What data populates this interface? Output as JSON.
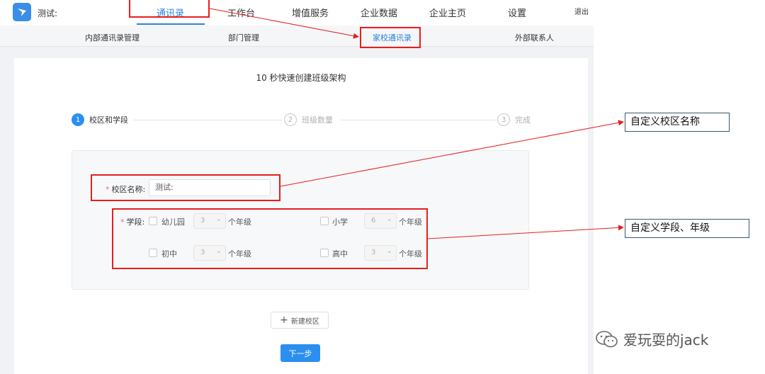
{
  "header": {
    "brand": "测试:",
    "nav": [
      {
        "label": "通讯录",
        "active": true
      },
      {
        "label": "工作台",
        "active": false
      },
      {
        "label": "增值服务",
        "active": false
      },
      {
        "label": "企业数据",
        "active": false
      },
      {
        "label": "企业主页",
        "active": false
      },
      {
        "label": "设置",
        "active": false
      }
    ],
    "logout": "退出"
  },
  "subnav": [
    {
      "label": "内部通讯录管理",
      "active": false
    },
    {
      "label": "部门管理",
      "active": false
    },
    {
      "label": "家校通讯录",
      "active": true
    },
    {
      "label": "外部联系人",
      "active": false
    }
  ],
  "page": {
    "title": "10 秒快速创建班级架构",
    "steps": [
      {
        "num": "1",
        "label": "校区和学段",
        "active": true
      },
      {
        "num": "2",
        "label": "班级数量",
        "active": false
      },
      {
        "num": "3",
        "label": "完成",
        "active": false
      }
    ]
  },
  "form": {
    "required_mark": "*",
    "campus_label": "校区名称:",
    "campus_value": "测试:",
    "stage_label": "学段:",
    "grade_suffix": "个年级",
    "chevron": "⌄",
    "stages": [
      {
        "name": "幼儿园",
        "grades": "3",
        "checked": false
      },
      {
        "name": "小学",
        "grades": "6",
        "checked": false
      },
      {
        "name": "初中",
        "grades": "3",
        "checked": false
      },
      {
        "name": "高中",
        "grades": "3",
        "checked": false
      }
    ]
  },
  "buttons": {
    "plus": "+",
    "add_campus": "新建校区",
    "next": "下一步"
  },
  "annotations": {
    "custom_campus": "自定义校区名称",
    "custom_stage": "自定义学段、年级",
    "color": "#e81e1e"
  },
  "watermark": {
    "text": "爱玩耍的jack"
  },
  "colors": {
    "primary": "#2b8fef",
    "active_text": "#2b7fde",
    "required": "#f56c6c"
  }
}
